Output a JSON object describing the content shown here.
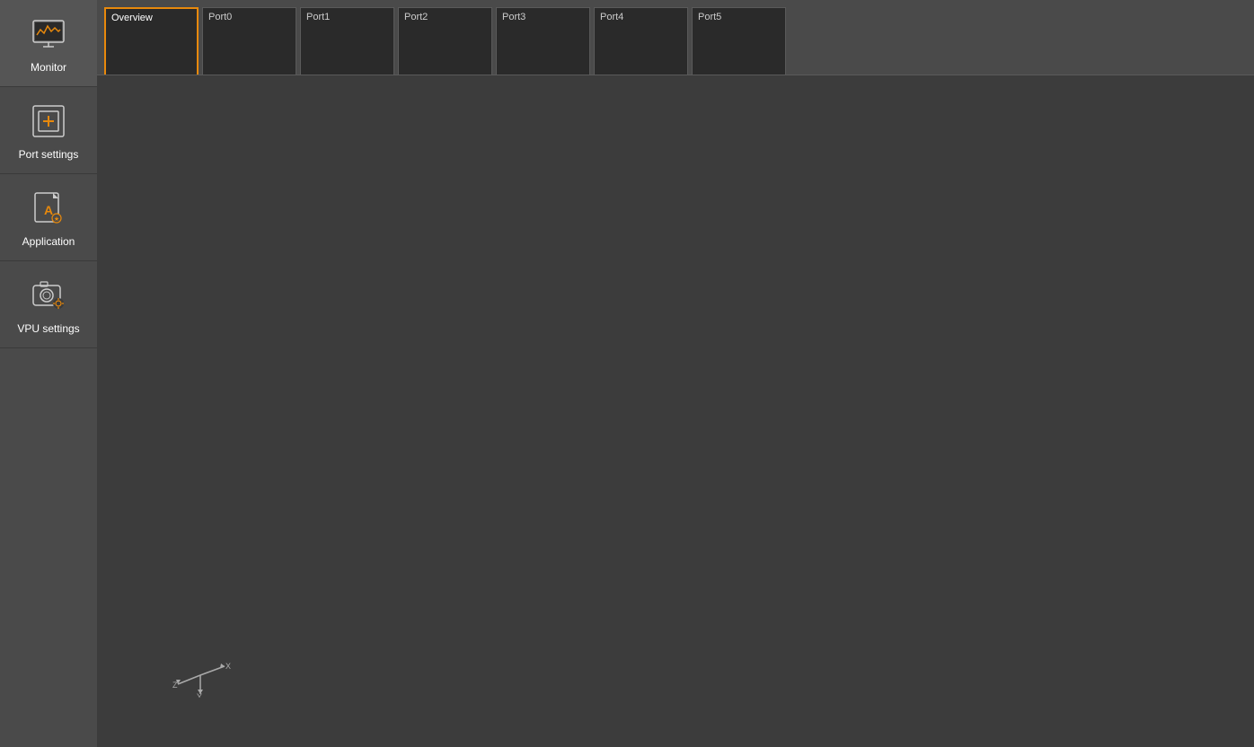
{
  "sidebar": {
    "items": [
      {
        "id": "monitor",
        "label": "Monitor",
        "icon": "monitor-icon"
      },
      {
        "id": "port-settings",
        "label": "Port settings",
        "icon": "port-settings-icon"
      },
      {
        "id": "application",
        "label": "Application",
        "icon": "application-icon"
      },
      {
        "id": "vpu-settings",
        "label": "VPU settings",
        "icon": "vpu-settings-icon"
      }
    ]
  },
  "tabs": [
    {
      "id": "overview",
      "label": "Overview",
      "active": true
    },
    {
      "id": "port0",
      "label": "Port0",
      "active": false
    },
    {
      "id": "port1",
      "label": "Port1",
      "active": false
    },
    {
      "id": "port2",
      "label": "Port2",
      "active": false
    },
    {
      "id": "port3",
      "label": "Port3",
      "active": false
    },
    {
      "id": "port4",
      "label": "Port4",
      "active": false
    },
    {
      "id": "port5",
      "label": "Port5",
      "active": false
    }
  ],
  "colors": {
    "accent": "#e8890c",
    "sidebar_bg": "#4a4a4a",
    "main_bg": "#3c3c3c",
    "tab_bg": "#2a2a2a"
  }
}
